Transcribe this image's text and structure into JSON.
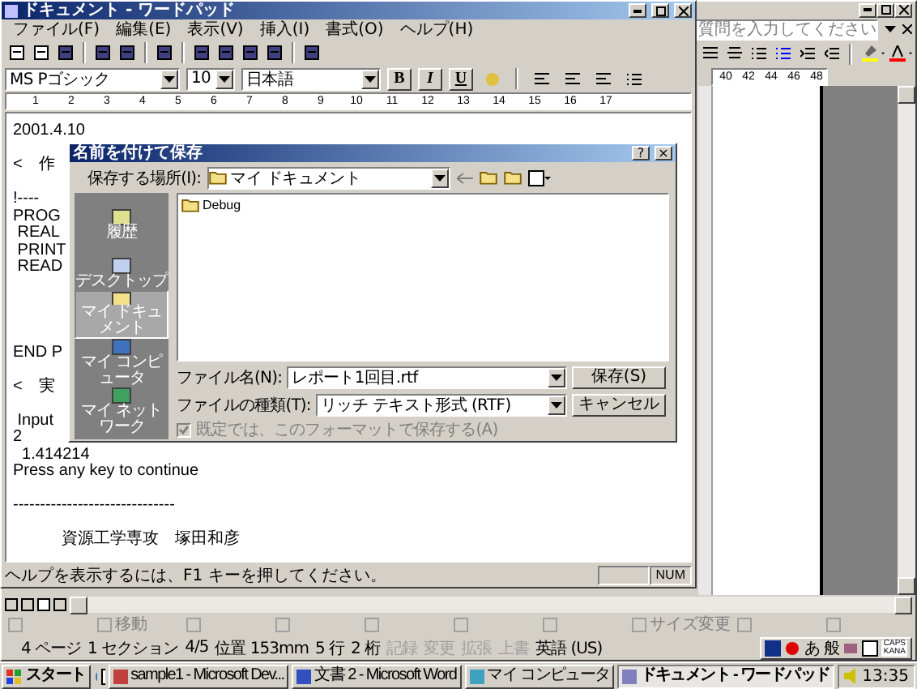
{
  "word": {
    "question_field": {
      "placeholder": "質問を入力してください"
    },
    "ruler_numbers": [
      "40",
      "42",
      "44",
      "46",
      "48"
    ],
    "drawing_toolbar": [
      {
        "kind": "button"
      },
      {
        "kind": "button",
        "label": "移動"
      },
      {
        "kind": "button"
      },
      {
        "kind": "button"
      },
      {
        "kind": "button"
      },
      {
        "kind": "button"
      },
      {
        "kind": "button"
      },
      {
        "kind": "button",
        "label": "サイズ変更"
      },
      {
        "kind": "button"
      },
      {
        "kind": "button"
      }
    ],
    "status_bar": [
      {
        "text": "4 ページ",
        "disabled": false
      },
      {
        "text": "1 セクション",
        "disabled": false
      },
      {
        "text": "4/5",
        "disabled": false
      },
      {
        "text": "位置 153mm",
        "disabled": false
      },
      {
        "text": "5 行",
        "disabled": false
      },
      {
        "text": "2 桁",
        "disabled": false
      },
      {
        "text": "記録",
        "disabled": true
      },
      {
        "text": "変更",
        "disabled": true
      },
      {
        "text": "拡張",
        "disabled": true
      },
      {
        "text": "上書",
        "disabled": true
      },
      {
        "text": "英語 (US)",
        "disabled": false
      }
    ],
    "ime_bar": [
      "あ",
      "般"
    ],
    "caps_kana": [
      "CAPS",
      "KANA"
    ]
  },
  "wordpad": {
    "title": "ドキュメント - ワードパッド",
    "menu": [
      "ファイル(F)",
      "編集(E)",
      "表示(V)",
      "挿入(I)",
      "書式(O)",
      "ヘルプ(H)"
    ],
    "font": "MS Pゴシック",
    "size": "10",
    "script": "日本語",
    "format_buttons": [
      "B",
      "I",
      "U"
    ],
    "ruler_numbers": [
      "1",
      "2",
      "3",
      "4",
      "5",
      "6",
      "7",
      "8",
      "9",
      "10",
      "11",
      "12",
      "13",
      "14",
      "15",
      "16",
      "17"
    ],
    "document_lines": [
      {
        "kind": "text",
        "text": "2001.4.10"
      },
      {
        "kind": "blank"
      },
      {
        "kind": "text",
        "text": "<　作"
      },
      {
        "kind": "blank"
      },
      {
        "kind": "text",
        "text": "!----"
      },
      {
        "kind": "text",
        "text": "PROG"
      },
      {
        "kind": "text",
        "text": " REAL"
      },
      {
        "kind": "text",
        "text": " PRINT"
      },
      {
        "kind": "text",
        "text": " READ"
      },
      {
        "kind": "blank"
      },
      {
        "kind": "blank"
      },
      {
        "kind": "blank"
      },
      {
        "kind": "blank"
      },
      {
        "kind": "text",
        "text": "END P"
      },
      {
        "kind": "blank"
      },
      {
        "kind": "text",
        "text": "<　実"
      },
      {
        "kind": "blank"
      },
      {
        "kind": "text",
        "text": " Input"
      },
      {
        "kind": "text",
        "text": "2"
      },
      {
        "kind": "text",
        "text": "  1.414214"
      },
      {
        "kind": "text",
        "text": "Press any key to continue"
      },
      {
        "kind": "blank"
      },
      {
        "kind": "text",
        "text": "------------------------------"
      },
      {
        "kind": "blank"
      },
      {
        "kind": "text",
        "text": "　　　資源工学専攻　塚田和彦"
      }
    ],
    "status_text": "ヘルプを表示するには、F1 キーを押してください。",
    "status_indicator": "NUM"
  },
  "save_dialog": {
    "title": "名前を付けて保存",
    "title_buttons": [
      "?",
      "×"
    ],
    "location_label": "保存する場所(I):",
    "location": "マイ ドキュメント",
    "places": [
      {
        "label": "履歴",
        "selected": false
      },
      {
        "label": "デスクトップ",
        "selected": false
      },
      {
        "label": "マイ ドキュメント",
        "selected": true
      },
      {
        "label": "マイ コンピュータ",
        "selected": false
      },
      {
        "label": "マイ ネットワーク",
        "selected": false
      }
    ],
    "files": [
      {
        "name": "Debug"
      }
    ],
    "filename_label": "ファイル名(N):",
    "filename": "レポート1回目.rtf",
    "type_label": "ファイルの種類(T):",
    "type": "リッチ テキスト形式 (RTF)",
    "buttons": [
      "保存(S)",
      "キャンセル"
    ],
    "default_format": {
      "label": "既定では、このフォーマットで保存する(A)",
      "checked": true,
      "disabled": true
    }
  },
  "taskbar": {
    "start": "スタート",
    "tasks": [
      {
        "label": "sample1 - Microsoft Dev...",
        "selected": false
      },
      {
        "label": "文書 2 - Microsoft Word",
        "selected": false
      },
      {
        "label": "マイ コンピュータ",
        "selected": false
      },
      {
        "label": "ドキュメント - ワードパッド",
        "selected": true
      }
    ],
    "clock": "13:35"
  }
}
